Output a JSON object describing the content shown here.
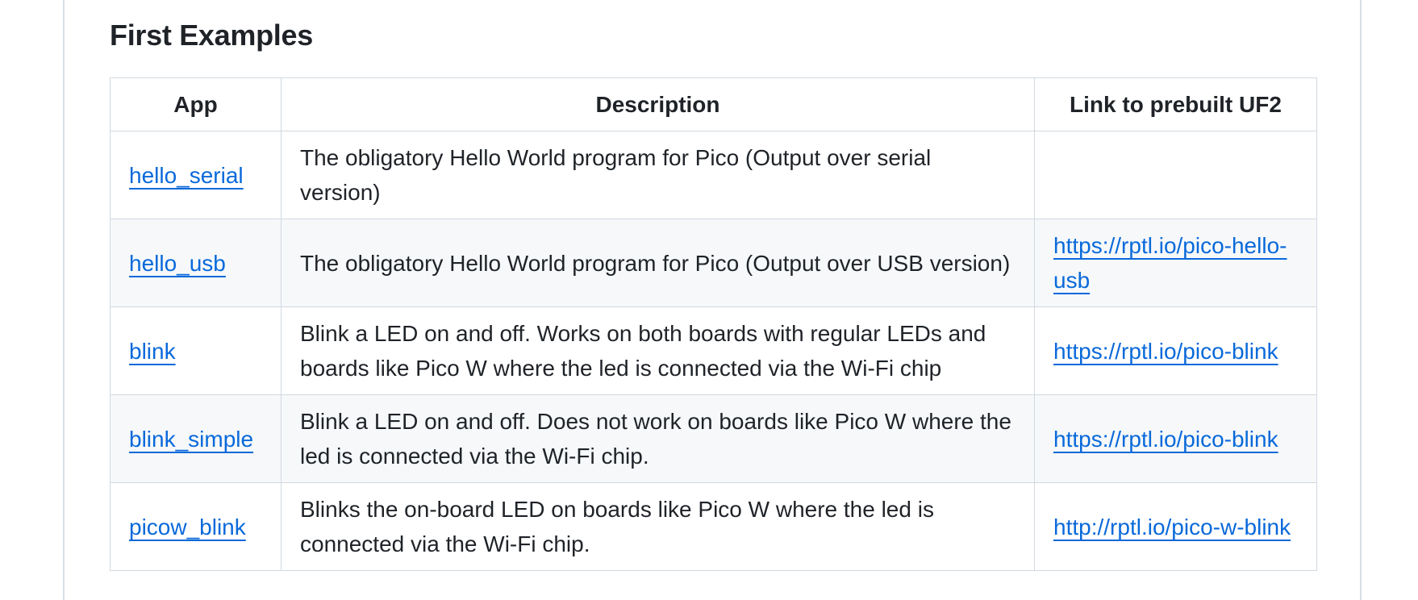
{
  "section": {
    "title": "First Examples"
  },
  "table": {
    "headers": [
      "App",
      "Description",
      "Link to prebuilt UF2"
    ],
    "rows": [
      {
        "app": "hello_serial",
        "description": "The obligatory Hello World program for Pico (Output over serial version)",
        "link": ""
      },
      {
        "app": "hello_usb",
        "description": "The obligatory Hello World program for Pico (Output over USB version)",
        "link": "https://rptl.io/pico-hello-usb"
      },
      {
        "app": "blink",
        "description": "Blink a LED on and off. Works on both boards with regular LEDs and boards like Pico W where the led is connected via the Wi-Fi chip",
        "link": "https://rptl.io/pico-blink"
      },
      {
        "app": "blink_simple",
        "description": "Blink a LED on and off. Does not work on boards like Pico W where the led is connected via the Wi-Fi chip.",
        "link": "https://rptl.io/pico-blink"
      },
      {
        "app": "picow_blink",
        "description": "Blinks the on-board LED on boards like Pico W where the led is connected via the Wi-Fi chip.",
        "link": "http://rptl.io/pico-w-blink"
      }
    ]
  },
  "colors": {
    "link": "#0969da",
    "text": "#1f2328",
    "border": "#d1d9e0",
    "stripe": "#f6f8fa"
  }
}
